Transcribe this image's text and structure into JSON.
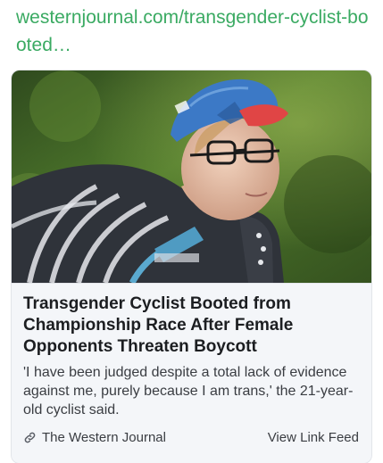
{
  "link": {
    "url_text": "westernjournal.com/transgender-cyclist-booted…"
  },
  "card": {
    "image_alt": "Cyclist in a blue and red cap and striped jersey",
    "title": "Transgender Cyclist Booted from Championship Race After Female Opponents Threaten Boycott",
    "description": "'I have been judged despite a total lack of evidence against me, purely because I am trans,' the 21-year-old cyclist said.",
    "source_name": "The Western Journal",
    "view_feed_label": "View Link Feed",
    "source_icon": "link-icon"
  },
  "colors": {
    "link_green": "#3aaa62",
    "card_background": "#f4f6f9",
    "title_text": "#1c1e21",
    "body_text": "#3a3d42"
  }
}
